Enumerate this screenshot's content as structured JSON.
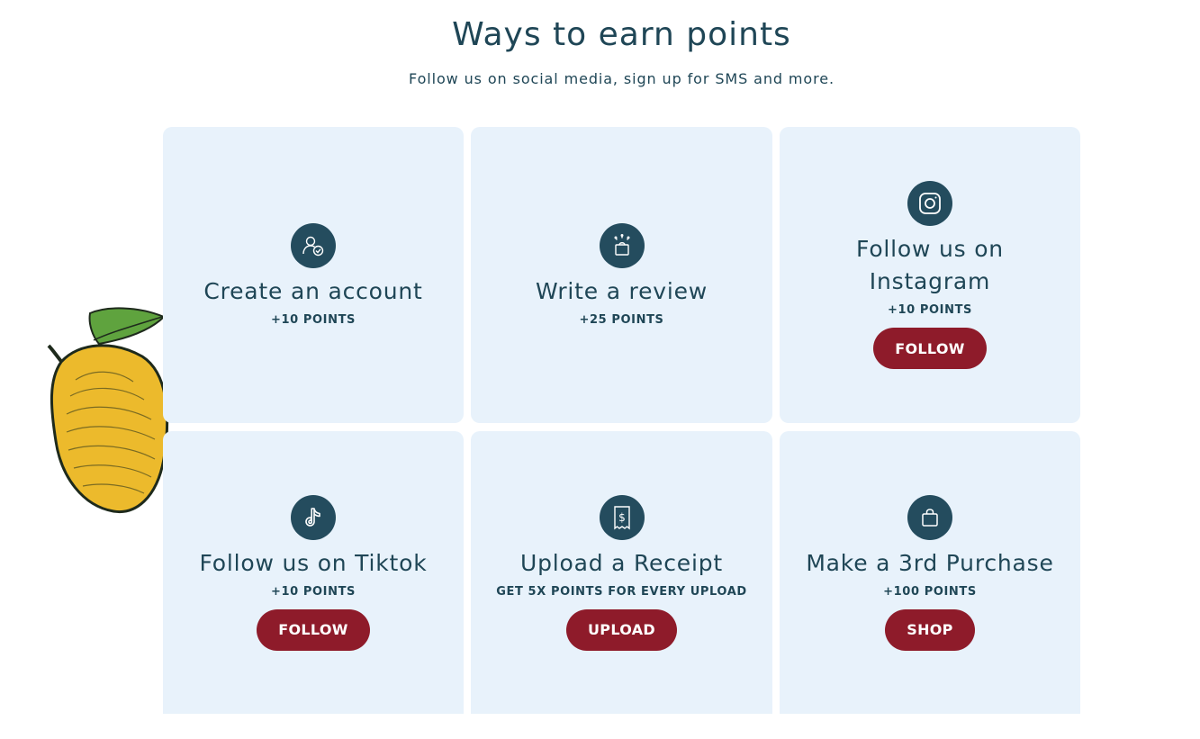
{
  "header": {
    "title": "Ways to earn points",
    "subtitle": "Follow us on social media, sign up for SMS and more."
  },
  "cards": [
    {
      "title": "Create an account",
      "points": "+10 POINTS",
      "icon": "user-check-icon"
    },
    {
      "title": "Write a review",
      "points": "+25 POINTS",
      "icon": "review-gift-icon"
    },
    {
      "title": "Follow us on Instagram",
      "points": "+10 POINTS",
      "button": "FOLLOW",
      "icon": "instagram-icon"
    },
    {
      "title": "Follow us on Tiktok",
      "points": "+10 POINTS",
      "button": "FOLLOW",
      "icon": "tiktok-icon"
    },
    {
      "title": "Upload a Receipt",
      "points": "GET 5X POINTS FOR EVERY UPLOAD",
      "button": "UPLOAD",
      "icon": "receipt-icon"
    },
    {
      "title": "Make a 3rd Purchase",
      "points": "+100 POINTS",
      "button": "SHOP",
      "icon": "shopping-bag-icon"
    }
  ],
  "colors": {
    "card_background": "#e8f2fb",
    "icon_background": "#244c5e",
    "text": "#1f4656",
    "button": "#8e1b2a"
  },
  "decoration": {
    "icon": "mango-illustration"
  }
}
